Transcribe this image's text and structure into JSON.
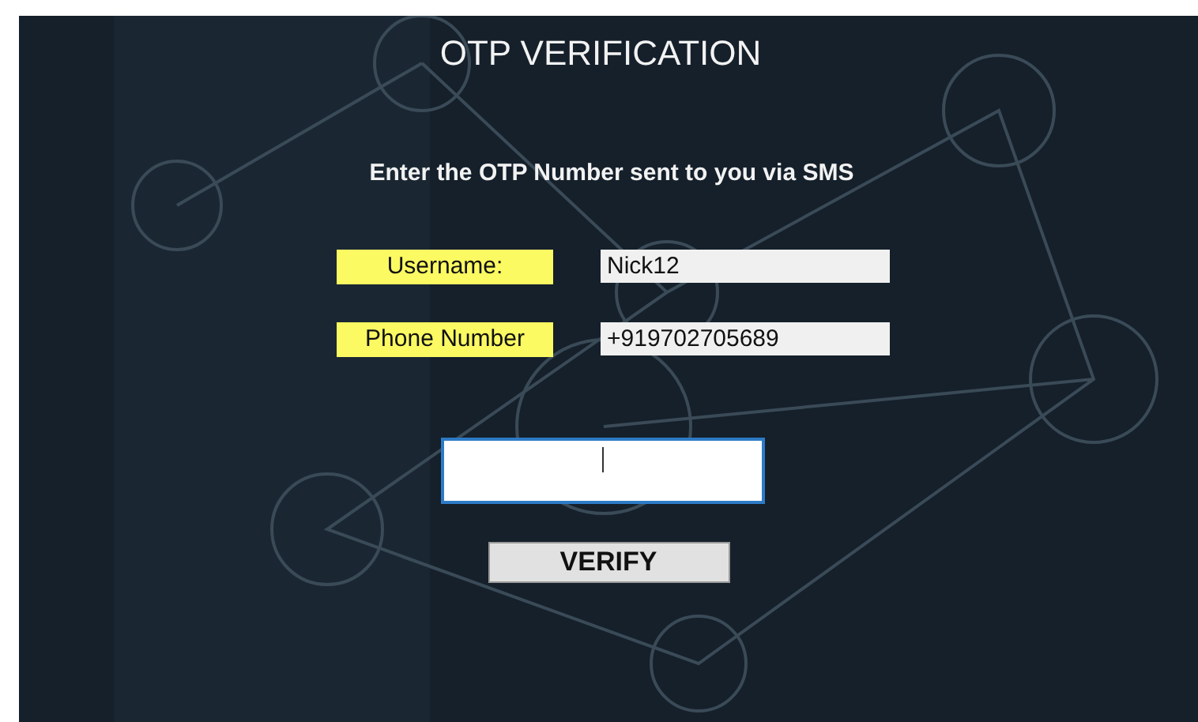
{
  "title": "OTP VERIFICATION",
  "instruction": "Enter the OTP Number sent to you via SMS",
  "fields": [
    {
      "label": "Username:",
      "value": "Nick12"
    },
    {
      "label": "Phone Number",
      "value": "+919702705689"
    }
  ],
  "otp_field": {
    "focused": true
  },
  "button": "VERIFY"
}
